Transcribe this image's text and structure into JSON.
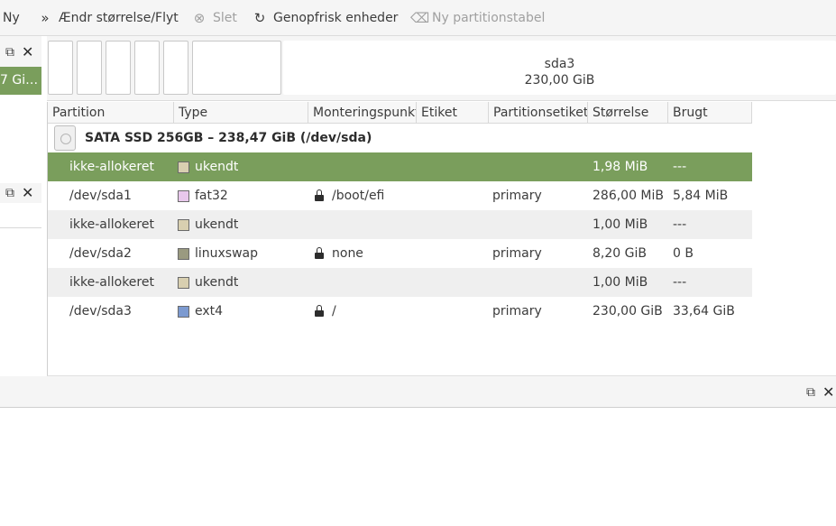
{
  "toolbar": {
    "new_label": "Ny",
    "resize_label": "Ændr størrelse/Flyt",
    "delete_label": "Slet",
    "refresh_label": "Genopfrisk enheder",
    "new_table_label": "Ny partitionstabel"
  },
  "left_panel": {
    "device_label": "7 Gi…"
  },
  "visual": {
    "big_partition_name": "sda3",
    "big_partition_size": "230,00 GiB"
  },
  "columns": [
    "Partition",
    "Type",
    "Monteringspunkt",
    "Etiket",
    "Partitionsetiket",
    "Størrelse",
    "Brugt"
  ],
  "device": {
    "label": "SATA SSD 256GB – 238,47 GiB (/dev/sda)"
  },
  "rows": [
    {
      "partition": "ikke-allokeret",
      "type": "ukendt",
      "color": "#d8cfb0",
      "mount": "",
      "locked": false,
      "etiket": "",
      "partlabel": "",
      "size": "1,98 MiB",
      "used": "---"
    },
    {
      "partition": "/dev/sda1",
      "type": "fat32",
      "color": "#e8c8ec",
      "mount": "/boot/efi",
      "locked": true,
      "etiket": "",
      "partlabel": "primary",
      "size": "286,00 MiB",
      "used": "5,84 MiB"
    },
    {
      "partition": "ikke-allokeret",
      "type": "ukendt",
      "color": "#d8cfb0",
      "mount": "",
      "locked": false,
      "etiket": "",
      "partlabel": "",
      "size": "1,00 MiB",
      "used": "---"
    },
    {
      "partition": "/dev/sda2",
      "type": "linuxswap",
      "color": "#9a9a80",
      "mount": "none",
      "locked": true,
      "etiket": "",
      "partlabel": "primary",
      "size": "8,20 GiB",
      "used": "0 B"
    },
    {
      "partition": "ikke-allokeret",
      "type": "ukendt",
      "color": "#d8cfb0",
      "mount": "",
      "locked": false,
      "etiket": "",
      "partlabel": "",
      "size": "1,00 MiB",
      "used": "---"
    },
    {
      "partition": "/dev/sda3",
      "type": "ext4",
      "color": "#7c9ad0",
      "mount": "/",
      "locked": true,
      "etiket": "",
      "partlabel": "primary",
      "size": "230,00 GiB",
      "used": "33,64 GiB"
    }
  ],
  "selected_row": 0,
  "colors": {
    "selection": "#7a9e5c",
    "toolbar_bg": "#f5f5f5"
  }
}
